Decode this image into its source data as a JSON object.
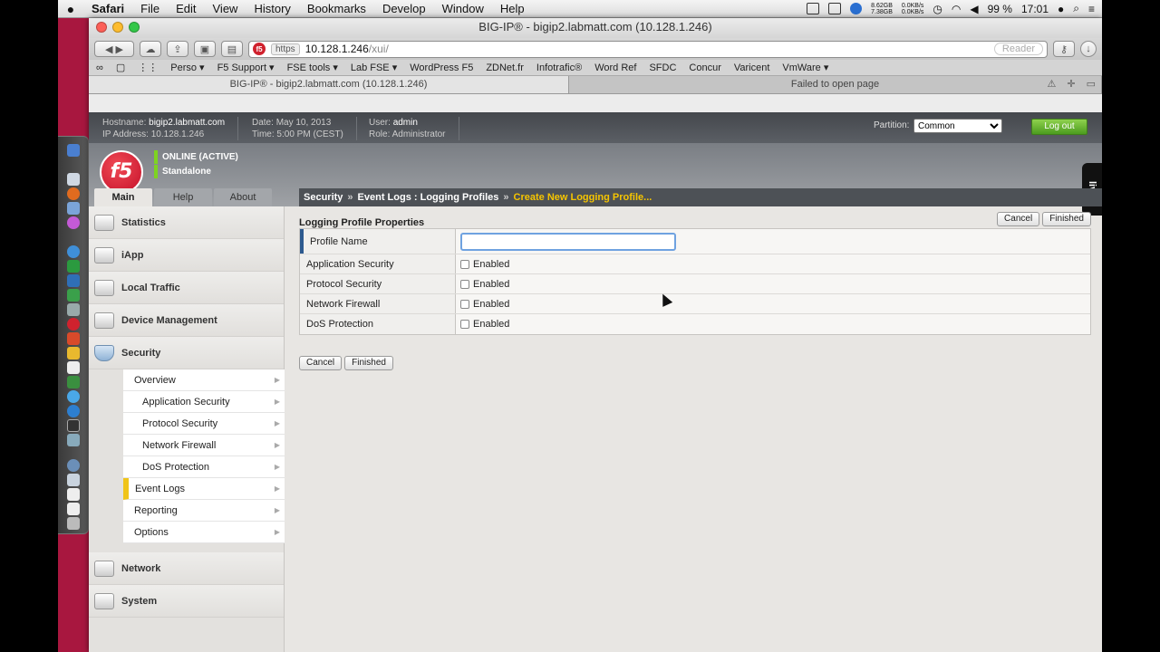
{
  "menubar": {
    "apple": "",
    "items": [
      "Safari",
      "File",
      "Edit",
      "View",
      "History",
      "Bookmarks",
      "Develop",
      "Window",
      "Help"
    ],
    "mem_top": "8.62GB",
    "mem_bottom": "7.38GB",
    "net_top": "0.0KB/s",
    "net_bottom": "0.0KB/s",
    "battery": "99 %",
    "clock": "17:01"
  },
  "browser": {
    "title": "BIG-IP® - bigip2.labmatt.com (10.128.1.246)",
    "url_scheme": "https",
    "url_host": "10.128.1.246",
    "url_path": "/xui/",
    "reader": "Reader",
    "bookmarks": [
      "Perso ▾",
      "F5 Support ▾",
      "FSE tools ▾",
      "Lab FSE ▾",
      "WordPress F5",
      "ZDNet.fr",
      "Infotrafic®",
      "Word Ref",
      "SFDC",
      "Concur",
      "Varicent",
      "VmWare ▾"
    ],
    "tab_active": "BIG-IP® - bigip2.labmatt.com (10.128.1.246)",
    "tab_other": "Failed to open page"
  },
  "banner": {
    "hostname_label": "Hostname:",
    "hostname": "bigip2.labmatt.com",
    "ip_label": "IP Address:",
    "ip": "10.128.1.246",
    "date_label": "Date:",
    "date": "May 10, 2013",
    "time_label": "Time:",
    "time": "5:00 PM (CEST)",
    "user_label": "User:",
    "user": "admin",
    "role_label": "Role:",
    "role": "Administrator",
    "partition_label": "Partition:",
    "partition_value": "Common",
    "logout": "Log out"
  },
  "header": {
    "logo": "f5",
    "status_online": "ONLINE (ACTIVE)",
    "status_mode": "Standalone",
    "live": "live",
    "tabs": [
      "Main",
      "Help",
      "About"
    ],
    "breadcrumb": [
      "Security",
      "Event Logs : Logging Profiles",
      "Create New Logging Profile..."
    ]
  },
  "leftnav": {
    "items_top": [
      "Statistics",
      "iApp",
      "Local Traffic",
      "Device Management",
      "Security"
    ],
    "submenu": [
      "Overview",
      "Application Security",
      "Protocol Security",
      "Network Firewall",
      "DoS Protection",
      "Event Logs",
      "Reporting",
      "Options"
    ],
    "items_bottom": [
      "Network",
      "System"
    ]
  },
  "content": {
    "section_title": "Logging Profile Properties",
    "cancel": "Cancel",
    "finished": "Finished",
    "rows": [
      {
        "label": "Profile Name",
        "value": ""
      },
      {
        "label": "Application Security",
        "value": "Enabled"
      },
      {
        "label": "Protocol Security",
        "value": "Enabled"
      },
      {
        "label": "Network Firewall",
        "value": "Enabled"
      },
      {
        "label": "DoS Protection",
        "value": "Enabled"
      }
    ]
  },
  "colors": {
    "accent": "#f5c400",
    "logout": "#4c9c1f",
    "f5_red": "#c5102a",
    "desktop": "#a8173f"
  }
}
